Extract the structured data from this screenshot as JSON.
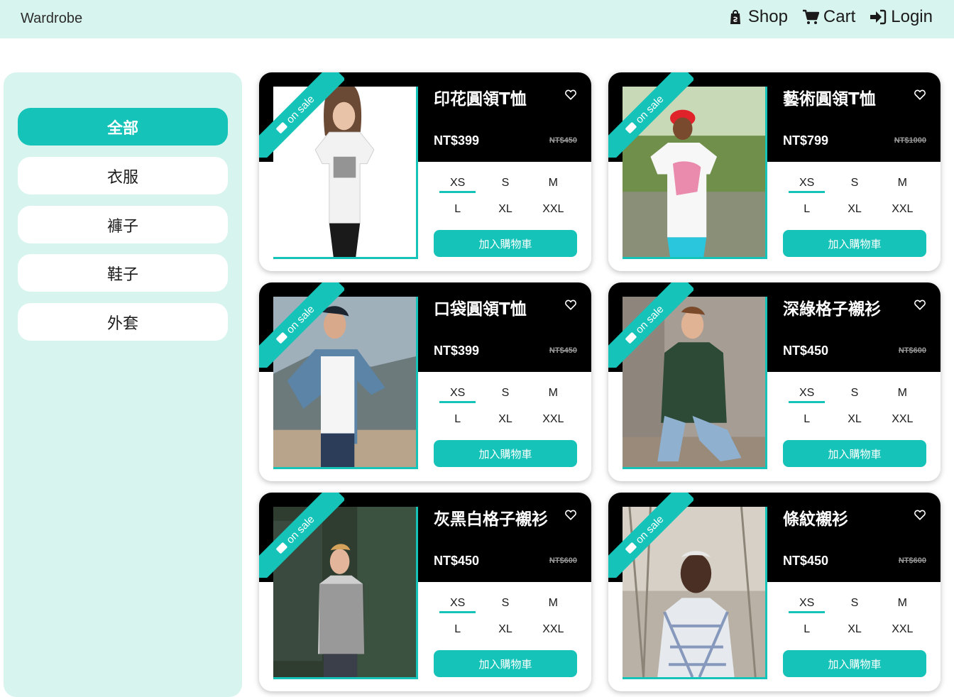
{
  "header": {
    "brand": "Wardrobe",
    "nav": [
      {
        "label": "Shop",
        "icon": "shopping-bag-icon"
      },
      {
        "label": "Cart",
        "icon": "cart-icon"
      },
      {
        "label": "Login",
        "icon": "sign-in-icon"
      }
    ]
  },
  "sidebar": {
    "categories": [
      {
        "label": "全部",
        "active": true
      },
      {
        "label": "衣服",
        "active": false
      },
      {
        "label": "褲子",
        "active": false
      },
      {
        "label": "鞋子",
        "active": false
      },
      {
        "label": "外套",
        "active": false
      }
    ]
  },
  "badge_label": "on sale",
  "add_to_cart_label": "加入購物車",
  "sizes": [
    "XS",
    "S",
    "M",
    "L",
    "XL",
    "XXL"
  ],
  "selected_size": "XS",
  "products": [
    {
      "name": "印花圓領T恤",
      "price": "NT$399",
      "original_price": "NT$450"
    },
    {
      "name": "藝術圓領T恤",
      "price": "NT$799",
      "original_price": "NT$1000"
    },
    {
      "name": "口袋圓領T恤",
      "price": "NT$399",
      "original_price": "NT$450"
    },
    {
      "name": "深綠格子襯衫",
      "price": "NT$450",
      "original_price": "NT$600"
    },
    {
      "name": "灰黑白格子襯衫",
      "price": "NT$450",
      "original_price": "NT$600"
    },
    {
      "name": "條紋襯衫",
      "price": "NT$450",
      "original_price": "NT$600"
    }
  ],
  "colors": {
    "accent": "#15c3b8",
    "header_bg": "#d8f4ef",
    "card_header_bg": "#000000"
  }
}
